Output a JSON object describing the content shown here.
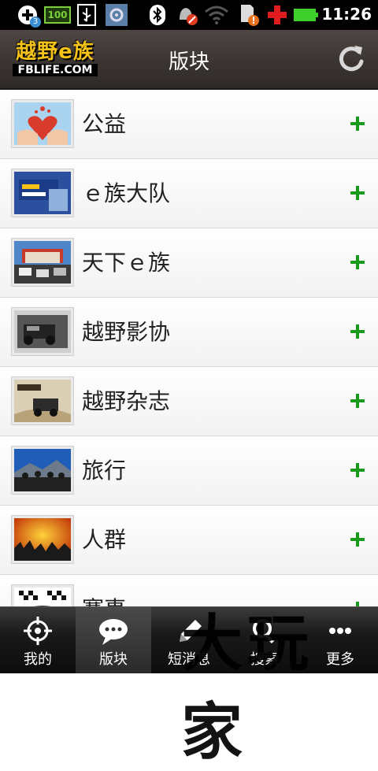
{
  "status_bar": {
    "time": "11:26",
    "battery_level_label": "100",
    "notification_count": "3"
  },
  "header": {
    "logo_top": "越野e族",
    "logo_bottom": "FBLIFE.COM",
    "title": "版块"
  },
  "forums": [
    {
      "label": "公益"
    },
    {
      "label": "ｅ族大队"
    },
    {
      "label": "天下ｅ族"
    },
    {
      "label": "越野影协"
    },
    {
      "label": "越野杂志"
    },
    {
      "label": "旅行"
    },
    {
      "label": "人群"
    },
    {
      "label": "赛事"
    }
  ],
  "tabs": [
    {
      "label": "我的"
    },
    {
      "label": "版块"
    },
    {
      "label": "短消息"
    },
    {
      "label": "搜索"
    },
    {
      "label": "更多"
    }
  ],
  "watermark": "大玩家",
  "colors": {
    "add_icon": "#1a9a1a",
    "logo_yellow": "#f5c21a",
    "header_bg": "#3a3431"
  }
}
